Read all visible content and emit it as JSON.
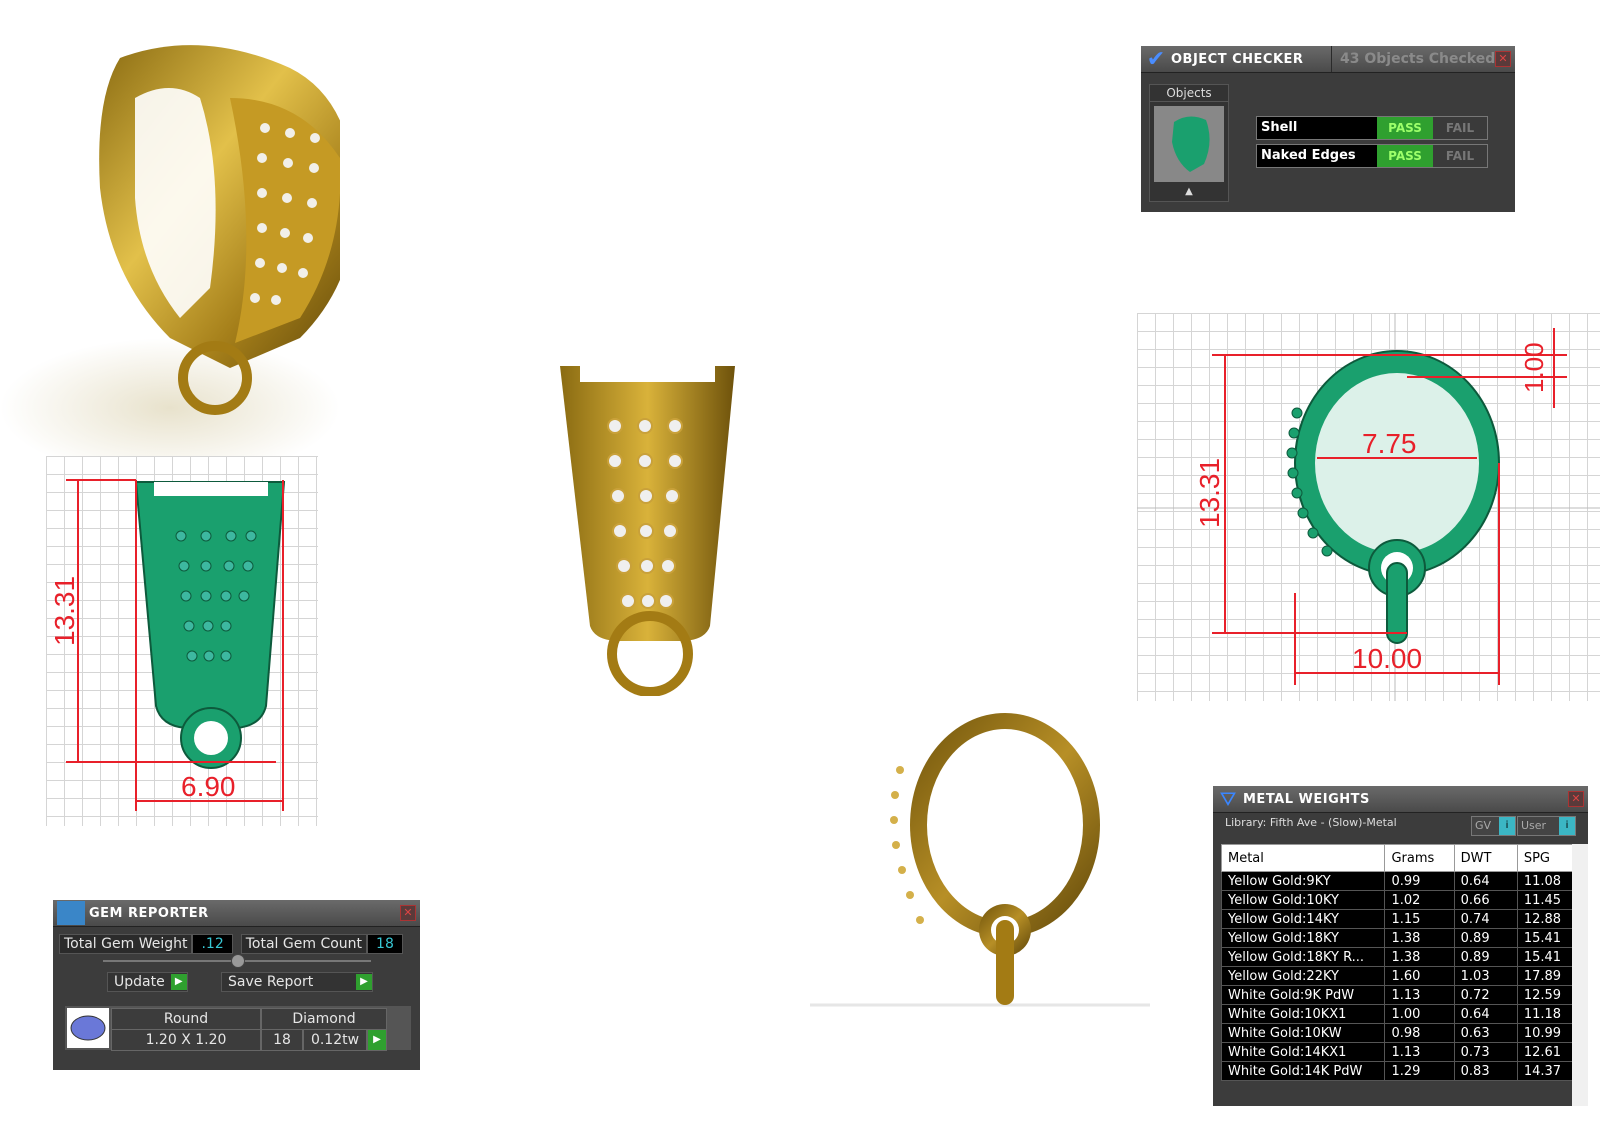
{
  "object_checker": {
    "title": "OBJECT CHECKER",
    "tab_status": "43  Objects Checked",
    "objects_label": "Objects",
    "checks": [
      {
        "label": "Shell",
        "pass": "PASS",
        "fail": "FAIL"
      },
      {
        "label": "Naked Edges",
        "pass": "PASS",
        "fail": "FAIL"
      }
    ]
  },
  "gem_reporter": {
    "title": "GEM REPORTER",
    "total_weight_label": "Total Gem Weight",
    "total_weight_value": ".12",
    "total_count_label": "Total Gem Count",
    "total_count_value": "18",
    "update_label": "Update",
    "save_report_label": "Save Report",
    "gem": {
      "shape": "Round",
      "material": "Diamond",
      "size": "1.20 X 1.20",
      "count": "18",
      "tw": "0.12tw"
    }
  },
  "metal_weights": {
    "title": "METAL WEIGHTS",
    "library": "Library: Fifth Ave - (Slow)-Metal",
    "gv_label": "GV",
    "user_label": "User",
    "columns": [
      "Metal",
      "Grams",
      "DWT",
      "SPG"
    ],
    "rows": [
      [
        "Yellow Gold:9KY",
        "0.99",
        "0.64",
        "11.08"
      ],
      [
        "Yellow Gold:10KY",
        "1.02",
        "0.66",
        "11.45"
      ],
      [
        "Yellow Gold:14KY",
        "1.15",
        "0.74",
        "12.88"
      ],
      [
        "Yellow Gold:18KY",
        "1.38",
        "0.89",
        "15.41"
      ],
      [
        "Yellow Gold:18KY R...",
        "1.38",
        "0.89",
        "15.41"
      ],
      [
        "Yellow Gold:22KY",
        "1.60",
        "1.03",
        "17.89"
      ],
      [
        "White Gold:9K PdW",
        "1.13",
        "0.72",
        "12.59"
      ],
      [
        "White Gold:10KX1",
        "1.00",
        "0.64",
        "11.18"
      ],
      [
        "White Gold:10KW",
        "0.98",
        "0.63",
        "10.99"
      ],
      [
        "White Gold:14KX1",
        "1.13",
        "0.73",
        "12.61"
      ],
      [
        "White Gold:14K PdW",
        "1.29",
        "0.83",
        "14.37"
      ]
    ]
  },
  "dimensions": {
    "front_height": "13.31",
    "front_width": "6.90",
    "side_height": "13.31",
    "side_inner": "7.75",
    "side_width": "10.00",
    "side_thickness": "1.00"
  },
  "colors": {
    "gold": "#b8860b",
    "model_green": "#1aa06e",
    "dimension_red": "#e8202a",
    "pass_green": "#2fa02f"
  }
}
